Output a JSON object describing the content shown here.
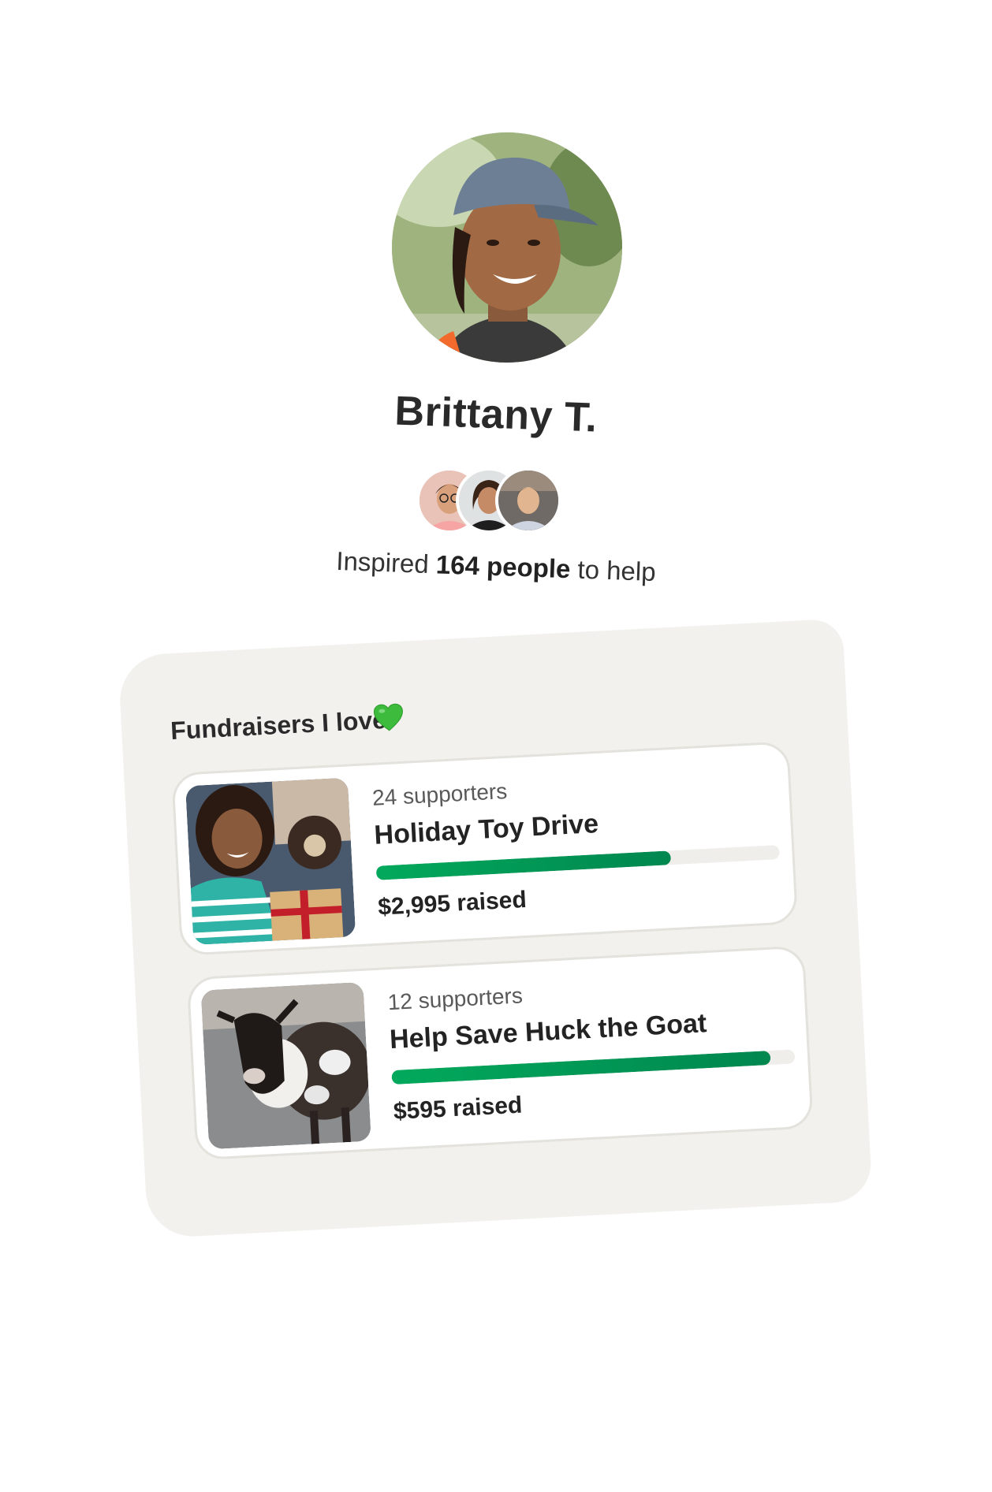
{
  "profile": {
    "name": "Brittany T.",
    "inspired_prefix": "Inspired ",
    "inspired_count": "164 people",
    "inspired_suffix": " to help"
  },
  "supporter_avatars": [
    "avatar",
    "avatar",
    "avatar"
  ],
  "fundraisers": {
    "title": "Fundraisers I love",
    "heart_icon": "green-heart-icon",
    "heart_color": "#3dbb3d",
    "progress_color": "#02a95c",
    "items": [
      {
        "supporters": "24 supporters",
        "title": "Holiday Toy Drive",
        "raised": "$2,995 raised",
        "progress": 0.73
      },
      {
        "supporters": "12 supporters",
        "title": "Help Save Huck the Goat",
        "raised": "$595 raised",
        "progress": 0.94
      }
    ]
  }
}
